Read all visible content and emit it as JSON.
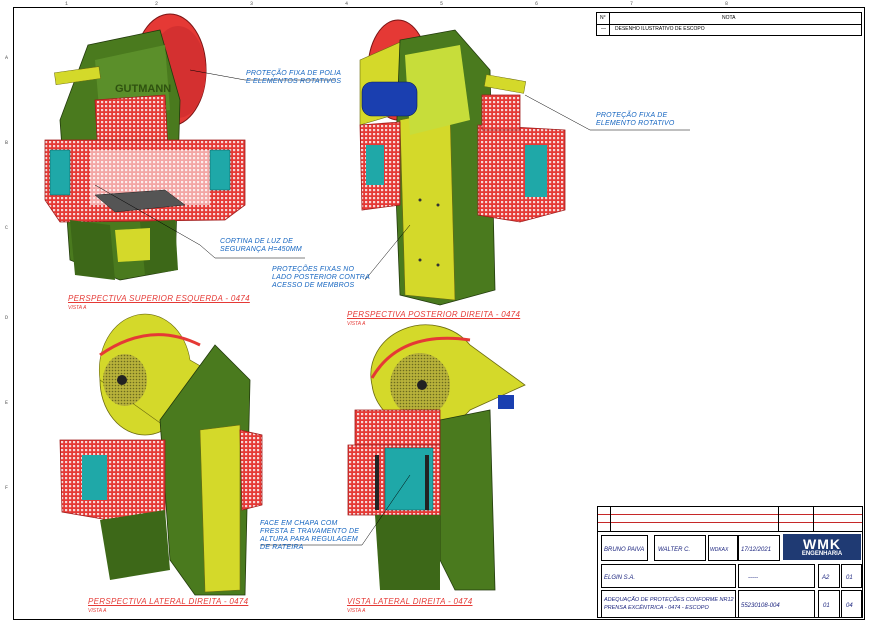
{
  "revision_table": {
    "rev_header": "N°",
    "desc_header": "NOTA",
    "rev_mark": "—",
    "rev_desc": "DESENHO ILUSTRATIVO DE ESCOPO"
  },
  "annotations": {
    "pulley_guard": "PROTEÇÃO FIXA DE POLIA E ELEMENTOS ROTATIVOS",
    "rotating_guard": "PROTEÇÃO FIXA DE ELEMENTO ROTATIVO",
    "light_curtain": "CORTINA DE LUZ DE SEGURANÇA H=450mm",
    "side_guards": "PROTEÇÕES FIXAS NO LADO POSTERIOR CONTRA ACESSO DE MEMBROS",
    "slot_face": "FACE EM CHAPA COM FRESTA E TRAVAMENTO DE ALTURA PARA REGULAGEM DE RATEIRA"
  },
  "views": [
    {
      "title": "PERSPECTIVA SUPERIOR ESQUERDA - 0474",
      "scale": "VISTA A"
    },
    {
      "title": "PERSPECTIVA POSTERIOR DIREITA - 0474",
      "scale": "VISTA A"
    },
    {
      "title": "PERSPECTIVA LATERAL DIREITA - 0474",
      "scale": "VISTA A"
    },
    {
      "title": "VISTA LATERAL DIREITA - 0474",
      "scale": "VISTA A"
    }
  ],
  "machine_brand": "GUTMANN",
  "title_block": {
    "designer": "BRUNO PAIVA",
    "reviewer": "WALTER C.",
    "approver": "WDKAX",
    "date": "17/12/2021",
    "client": "ELGIN S.A.",
    "ref": "-----",
    "size": "A2",
    "sheet": "01",
    "title_line1": "ADEQUAÇÃO DE PROTEÇÕES CONFORME NR12",
    "title_line2": "PRENSA EXCÊNTRICA - 0474 - ESCOPO",
    "drawing_no": "55230108-004",
    "rev": "01",
    "total_sheets": "04",
    "company": "WMK",
    "company_sub": "ENGENHARIA"
  },
  "colors": {
    "guard_red": "#e53935",
    "frame_green": "#4a7a1e",
    "yellow": "#d4d92a",
    "motor_blue": "#1a3fb0",
    "panel_cyan": "#1fa8a8",
    "annotation_blue": "#1565c0"
  }
}
